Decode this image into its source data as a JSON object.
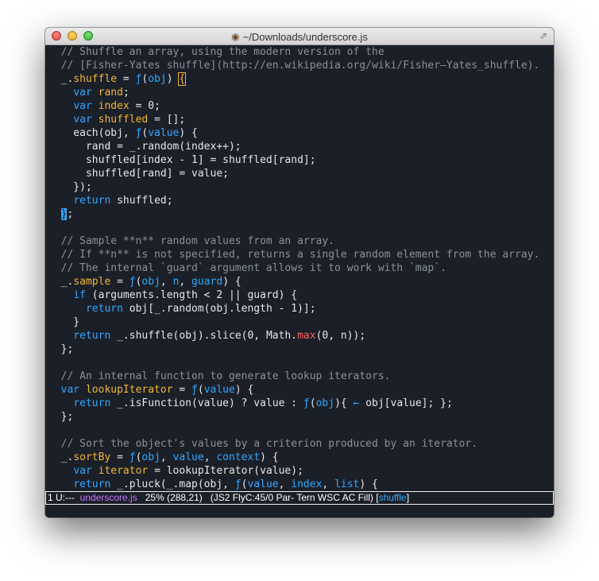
{
  "window": {
    "title": "~/Downloads/underscore.js",
    "title_icon": "gnu-icon"
  },
  "editor": {
    "lines": [
      [
        [
          "c",
          "  // Shuffle an array, using the modern version of the"
        ]
      ],
      [
        [
          "c",
          "  // [Fisher-Yates shuffle](http://en.wikipedia.org/wiki/Fisher–Yates_shuffle)."
        ]
      ],
      [
        [
          "o",
          "  _."
        ],
        [
          "v",
          "shuffle"
        ],
        [
          "o",
          " = "
        ],
        [
          "k",
          "ƒ"
        ],
        [
          "o",
          "("
        ],
        [
          "k",
          "obj"
        ],
        [
          "o",
          ") "
        ],
        [
          "cb",
          "{"
        ]
      ],
      [
        [
          "o",
          "    "
        ],
        [
          "k",
          "var"
        ],
        [
          "o",
          " "
        ],
        [
          "v",
          "rand"
        ],
        [
          "o",
          ";"
        ]
      ],
      [
        [
          "o",
          "    "
        ],
        [
          "k",
          "var"
        ],
        [
          "o",
          " "
        ],
        [
          "v",
          "index"
        ],
        [
          "o",
          " = 0;"
        ]
      ],
      [
        [
          "o",
          "    "
        ],
        [
          "k",
          "var"
        ],
        [
          "o",
          " "
        ],
        [
          "v",
          "shuffled"
        ],
        [
          "o",
          " = [];"
        ]
      ],
      [
        [
          "o",
          "    each(obj, "
        ],
        [
          "k",
          "ƒ"
        ],
        [
          "o",
          "("
        ],
        [
          "k",
          "value"
        ],
        [
          "o",
          ") {"
        ]
      ],
      [
        [
          "o",
          "      rand = _.random(index++);"
        ]
      ],
      [
        [
          "o",
          "      shuffled[index - 1] = shuffled[rand];"
        ]
      ],
      [
        [
          "o",
          "      shuffled[rand] = value;"
        ]
      ],
      [
        [
          "o",
          "    });"
        ]
      ],
      [
        [
          "o",
          "    "
        ],
        [
          "k",
          "return"
        ],
        [
          "o",
          " shuffled;"
        ]
      ],
      [
        [
          "o",
          "  "
        ],
        [
          "cc",
          "}"
        ],
        [
          "o",
          ";"
        ]
      ],
      [
        [
          "o",
          ""
        ]
      ],
      [
        [
          "c",
          "  // Sample **n** random values from an array."
        ]
      ],
      [
        [
          "c",
          "  // If **n** is not specified, returns a single random element from the array."
        ]
      ],
      [
        [
          "c",
          "  // The internal `guard` argument allows it to work with `map`."
        ]
      ],
      [
        [
          "o",
          "  _."
        ],
        [
          "v",
          "sample"
        ],
        [
          "o",
          " = "
        ],
        [
          "k",
          "ƒ"
        ],
        [
          "o",
          "("
        ],
        [
          "k",
          "obj"
        ],
        [
          "o",
          ", "
        ],
        [
          "k",
          "n"
        ],
        [
          "o",
          ", "
        ],
        [
          "k",
          "guard"
        ],
        [
          "o",
          ") {"
        ]
      ],
      [
        [
          "o",
          "    "
        ],
        [
          "k",
          "if"
        ],
        [
          "o",
          " (arguments.length < 2 || guard) {"
        ]
      ],
      [
        [
          "o",
          "      "
        ],
        [
          "k",
          "return"
        ],
        [
          "o",
          " obj[_.random(obj.length - 1)];"
        ]
      ],
      [
        [
          "o",
          "    }"
        ]
      ],
      [
        [
          "o",
          "    "
        ],
        [
          "k",
          "return"
        ],
        [
          "o",
          " _.shuffle(obj).slice(0, Math."
        ],
        [
          "r",
          "max"
        ],
        [
          "o",
          "(0, n));"
        ]
      ],
      [
        [
          "o",
          "  };"
        ]
      ],
      [
        [
          "o",
          ""
        ]
      ],
      [
        [
          "c",
          "  // An internal function to generate lookup iterators."
        ]
      ],
      [
        [
          "o",
          "  "
        ],
        [
          "k",
          "var"
        ],
        [
          "o",
          " "
        ],
        [
          "v",
          "lookupIterator"
        ],
        [
          "o",
          " = "
        ],
        [
          "k",
          "ƒ"
        ],
        [
          "o",
          "("
        ],
        [
          "k",
          "value"
        ],
        [
          "o",
          ") {"
        ]
      ],
      [
        [
          "o",
          "    "
        ],
        [
          "k",
          "return"
        ],
        [
          "o",
          " _.isFunction(value) ? value : "
        ],
        [
          "k",
          "ƒ"
        ],
        [
          "o",
          "("
        ],
        [
          "k",
          "obj"
        ],
        [
          "o",
          "){ "
        ],
        [
          "k",
          "←"
        ],
        [
          "o",
          " obj[value]; };"
        ]
      ],
      [
        [
          "o",
          "  };"
        ]
      ],
      [
        [
          "o",
          ""
        ]
      ],
      [
        [
          "c",
          "  // Sort the object's values by a criterion produced by an iterator."
        ]
      ],
      [
        [
          "o",
          "  _."
        ],
        [
          "v",
          "sortBy"
        ],
        [
          "o",
          " = "
        ],
        [
          "k",
          "ƒ"
        ],
        [
          "o",
          "("
        ],
        [
          "k",
          "obj"
        ],
        [
          "o",
          ", "
        ],
        [
          "k",
          "value"
        ],
        [
          "o",
          ", "
        ],
        [
          "k",
          "context"
        ],
        [
          "o",
          ") {"
        ]
      ],
      [
        [
          "o",
          "    "
        ],
        [
          "k",
          "var"
        ],
        [
          "o",
          " "
        ],
        [
          "v",
          "iterator"
        ],
        [
          "o",
          " = lookupIterator(value);"
        ]
      ],
      [
        [
          "o",
          "    "
        ],
        [
          "k",
          "return"
        ],
        [
          "o",
          " _.pluck(_.map(obj, "
        ],
        [
          "k",
          "ƒ"
        ],
        [
          "o",
          "("
        ],
        [
          "k",
          "value"
        ],
        [
          "o",
          ", "
        ],
        [
          "k",
          "index"
        ],
        [
          "o",
          ", "
        ],
        [
          "k",
          "list"
        ],
        [
          "o",
          ") {"
        ]
      ]
    ]
  },
  "modeline": {
    "prefix": "1 U:---  ",
    "filename": "underscore.js",
    "position": "   25% (288,21)   (JS2 FlyC:45/0 Par- Tern WSC AC Fill) [",
    "function": "shuffle",
    "suffix": "]"
  },
  "colors": {
    "background": "#1b1f28",
    "comment": "#8a9099",
    "keyword": "#2ea8ff",
    "variable": "#f2b632",
    "builtin": "#ff5f5f",
    "modeline_file": "#c777ff"
  }
}
